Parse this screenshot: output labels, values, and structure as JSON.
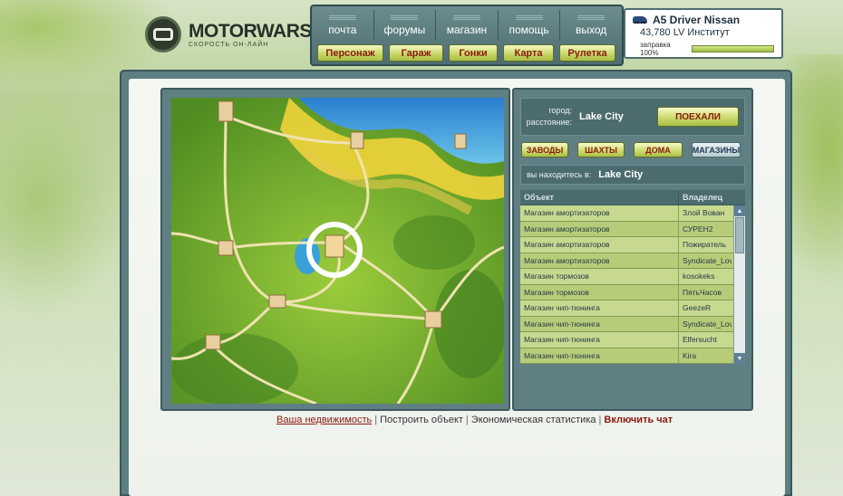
{
  "logo": {
    "title": "MOTORWARS.RU",
    "subtitle": "СКОРОСТЬ ОН-ЛАЙН"
  },
  "top_nav": [
    "почта",
    "форумы",
    "магазин",
    "помощь",
    "выход"
  ],
  "green_nav": [
    "Персонаж",
    "Гараж",
    "Гонки",
    "Карта",
    "Рулетка"
  ],
  "player": {
    "car": "A5 Driver Nissan",
    "balance": "43,780 LV Институт",
    "fuel_label": "заправка 100%",
    "fuel_level": 1.0
  },
  "city_panel": {
    "city_label": "город:",
    "city_value": "Lake City",
    "distance_label": "расстояние:",
    "distance_value": "",
    "go_button": "ПОЕХАЛИ"
  },
  "categories": [
    {
      "label": "ЗАВОДЫ",
      "active": false
    },
    {
      "label": "ШАХТЫ",
      "active": false
    },
    {
      "label": "ДОМА",
      "active": false
    },
    {
      "label": "МАГАЗИНЫ",
      "active": true
    }
  ],
  "location": {
    "label": "вы находитесь в:",
    "city": "Lake City"
  },
  "table": {
    "headers": [
      "Объект",
      "Владелец"
    ],
    "rows": [
      [
        "Магазин амортизаторов",
        "Злой Вован"
      ],
      [
        "Магазин амортизаторов",
        "СУРЕН2"
      ],
      [
        "Магазин амортизаторов",
        "Пожиратель"
      ],
      [
        "Магазин амортизаторов",
        "Syndicate_Lov"
      ],
      [
        "Магазин тормозов",
        "kosokeks"
      ],
      [
        "Магазин тормозов",
        "ПятьЧасов"
      ],
      [
        "Магазин чип-тюнинга",
        "GeezeR"
      ],
      [
        "Магазин чип-тюнинга",
        "Syndicate_Lov"
      ],
      [
        "Магазин чип-тюнинга",
        "Elfersucht"
      ],
      [
        "Магазин чип-тюнинга",
        "Kira"
      ]
    ]
  },
  "bottom_links": [
    "Ваша недвижимость",
    "Построить объект",
    "Экономическая статистика",
    "Включить чат"
  ],
  "colors": {
    "accent_red": "#8b1a10",
    "frame": "#5f7f83",
    "button_green": "#c8d86b"
  }
}
